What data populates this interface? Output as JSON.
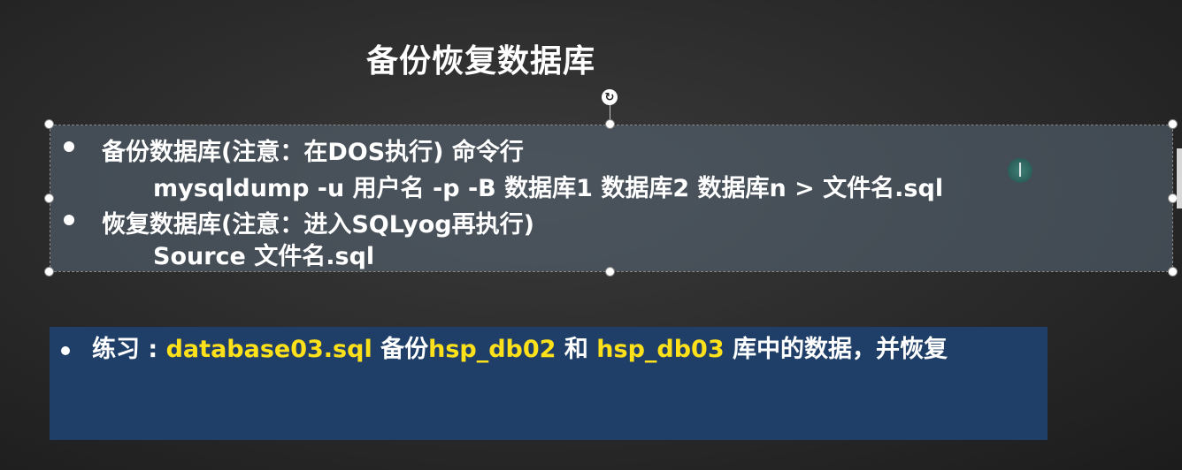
{
  "slide": {
    "title": "备份恢复数据库",
    "lines": {
      "b1_heading": "备份数据库(注意：在DOS执行) 命令行",
      "b1_command": "mysqldump -u 用户名 -p -B 数据库1 数据库2 数据库n > 文件名.sql",
      "b2_heading": "恢复数据库(注意：进入SQLyog再执行)",
      "b2_command": "Source 文件名.sql"
    },
    "exercise": {
      "label": "练习 : ",
      "file": "database03.sql",
      "t1": " 备份",
      "db1": "hsp_db02",
      "t2": " 和 ",
      "db2": "hsp_db03",
      "t3": " 库中的数据，并恢复"
    }
  },
  "colors": {
    "background": "#2a2a2a",
    "text": "#ffffff",
    "highlight": "#ffe11a",
    "exercise_bg": "#1f3f68",
    "content_bg": "#56646f"
  },
  "icons": {
    "rotate": "rotate-icon",
    "cursor": "text-cursor-icon"
  }
}
